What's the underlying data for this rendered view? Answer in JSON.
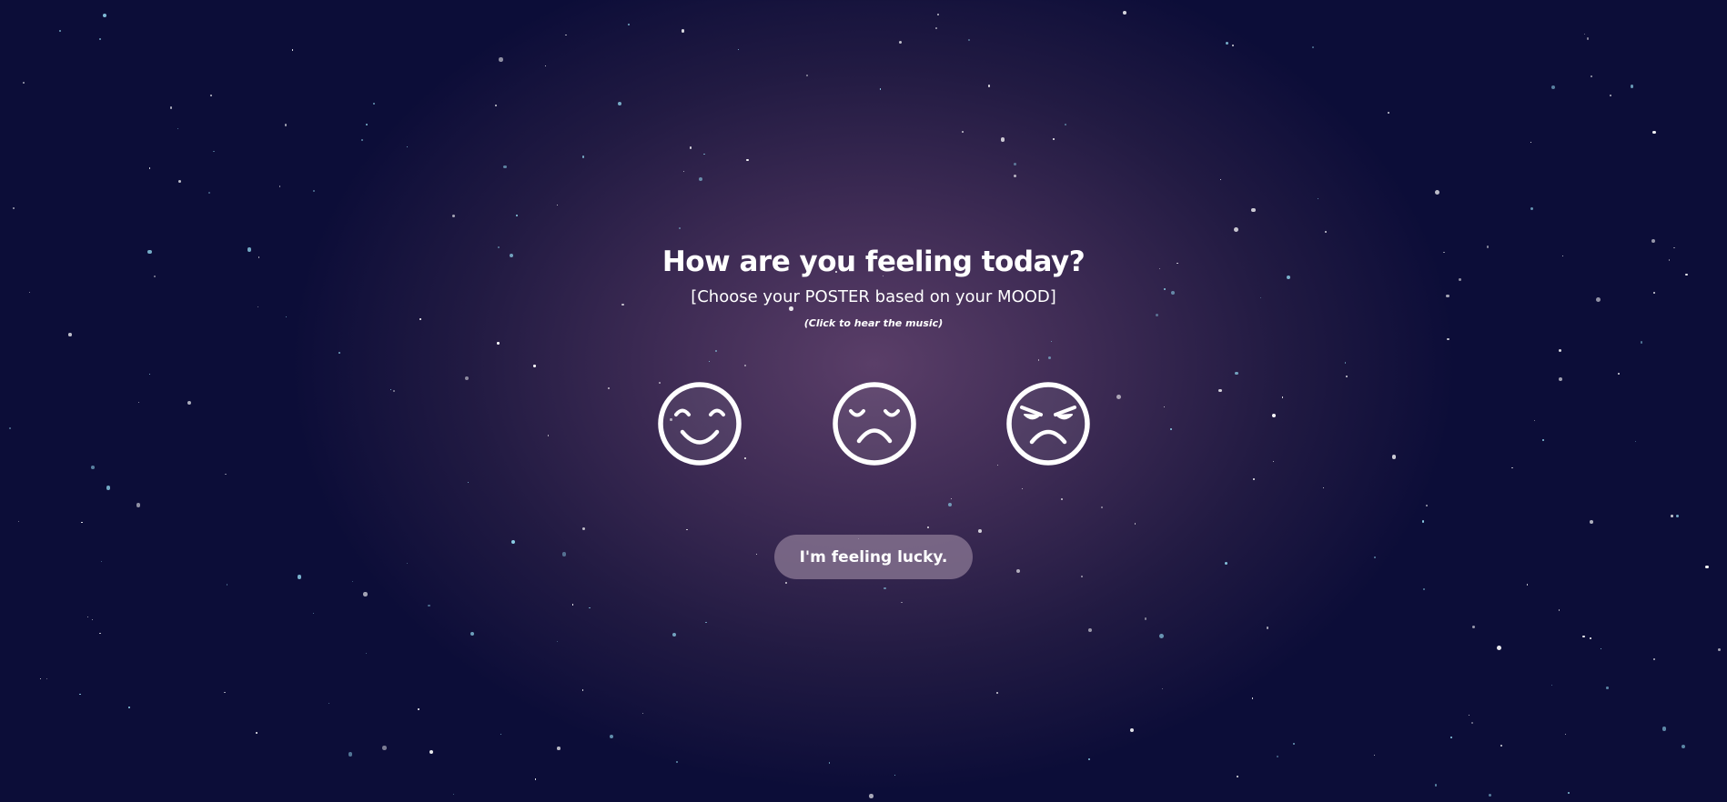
{
  "page": {
    "title": "How are you feeling today?",
    "subtitle": "[Choose your POSTER based on your MOOD]",
    "hint": "(Click to hear the music)"
  },
  "moods": [
    {
      "icon": "happy-face-icon"
    },
    {
      "icon": "sad-face-icon"
    },
    {
      "icon": "angry-face-icon"
    }
  ],
  "lucky_button": {
    "label": "I'm feeling lucky."
  },
  "colors": {
    "background_center": "#5a3e68",
    "background_edge": "#0c0d38",
    "star_white": "#ffffff",
    "star_blue": "#8fd3ea",
    "button_bg": "#8c7a96"
  }
}
